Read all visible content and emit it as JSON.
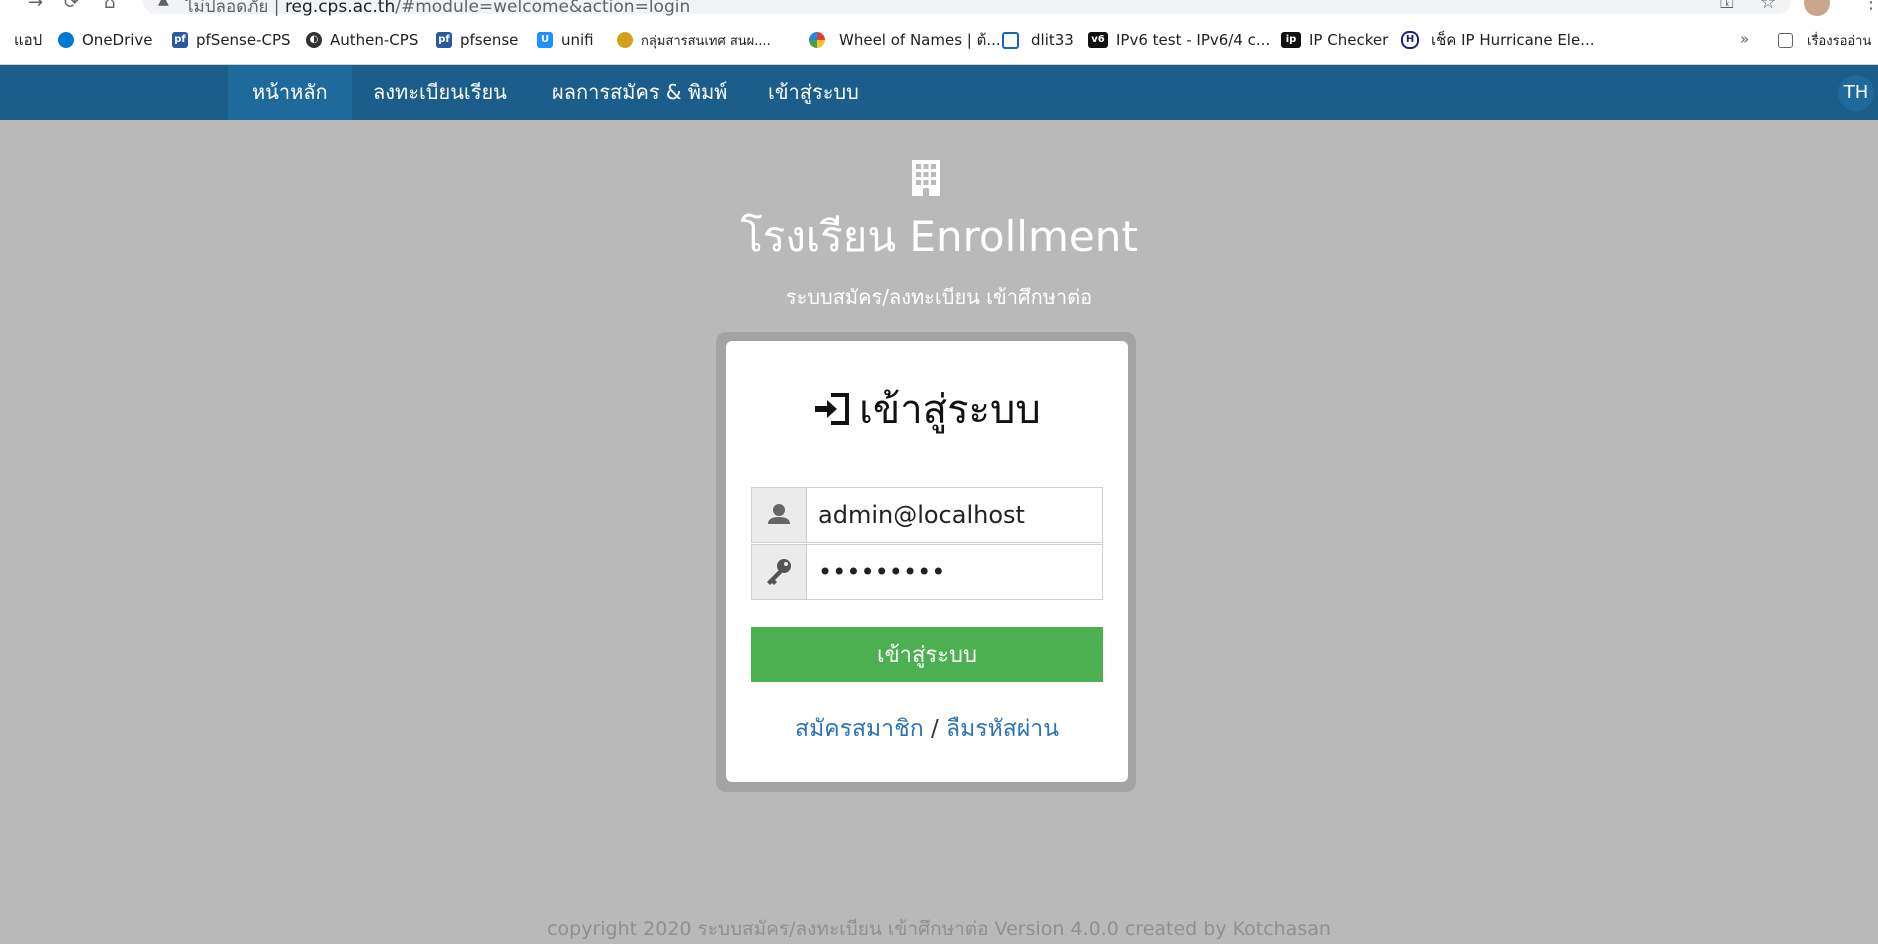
{
  "browser": {
    "security_label": "ไม่ปลอดภัย",
    "url_host": "reg.cps.ac.th",
    "url_path": "/#module=welcome&action=login",
    "bookmarks": [
      {
        "label": "แอป",
        "color": "#e8710a"
      },
      {
        "label": "OneDrive",
        "color": "#0078d4"
      },
      {
        "label": "pfSense-CPS",
        "color": "#2c5aa0"
      },
      {
        "label": "Authen-CPS",
        "color": "#333333"
      },
      {
        "label": "pfsense",
        "color": "#2c5aa0"
      },
      {
        "label": "unifi",
        "color": "#1e90ff"
      },
      {
        "label": "กลุ่มสารสนเทศ สนผ....",
        "color": "#d4a017"
      },
      {
        "label": "Wheel of Names | ต้...",
        "color": "#e53935"
      },
      {
        "label": "dlit33",
        "color": "#1565c0"
      },
      {
        "label": "IPv6 test - IPv6/4 c...",
        "color": "#111111"
      },
      {
        "label": "IP Checker",
        "color": "#111111"
      },
      {
        "label": "เช็ค IP Hurricane Ele...",
        "color": "#1a237e"
      }
    ],
    "overflow": "»",
    "reading_list": "เรื่องรออ่าน"
  },
  "navbar": {
    "items": [
      "หน้าหลัก",
      "ลงทะเบียนเรียน",
      "ผลการสมัคร & พิมพ์",
      "เข้าสู่ระบบ"
    ],
    "lang": "TH"
  },
  "site": {
    "title": "โรงเรียน Enrollment",
    "subtitle": "ระบบสมัคร/ลงทะเบียน เข้าศึกษาต่อ"
  },
  "login": {
    "heading": "เข้าสู่ระบบ",
    "username": "admin@localhost",
    "password": "•••••••••",
    "submit": "เข้าสู่ระบบ",
    "register": "สมัครสมาชิก",
    "separator": " / ",
    "forgot": "ลืมรหัสผ่าน"
  },
  "footer": "copyright 2020 ระบบสมัคร/ลงทะเบียน เข้าศึกษาต่อ Version 4.0.0 created by Kotchasan",
  "colors": {
    "navbar": "#1b5e8c",
    "button": "#4caf50",
    "link": "#2b73b6",
    "background": "#b9b9b9"
  }
}
